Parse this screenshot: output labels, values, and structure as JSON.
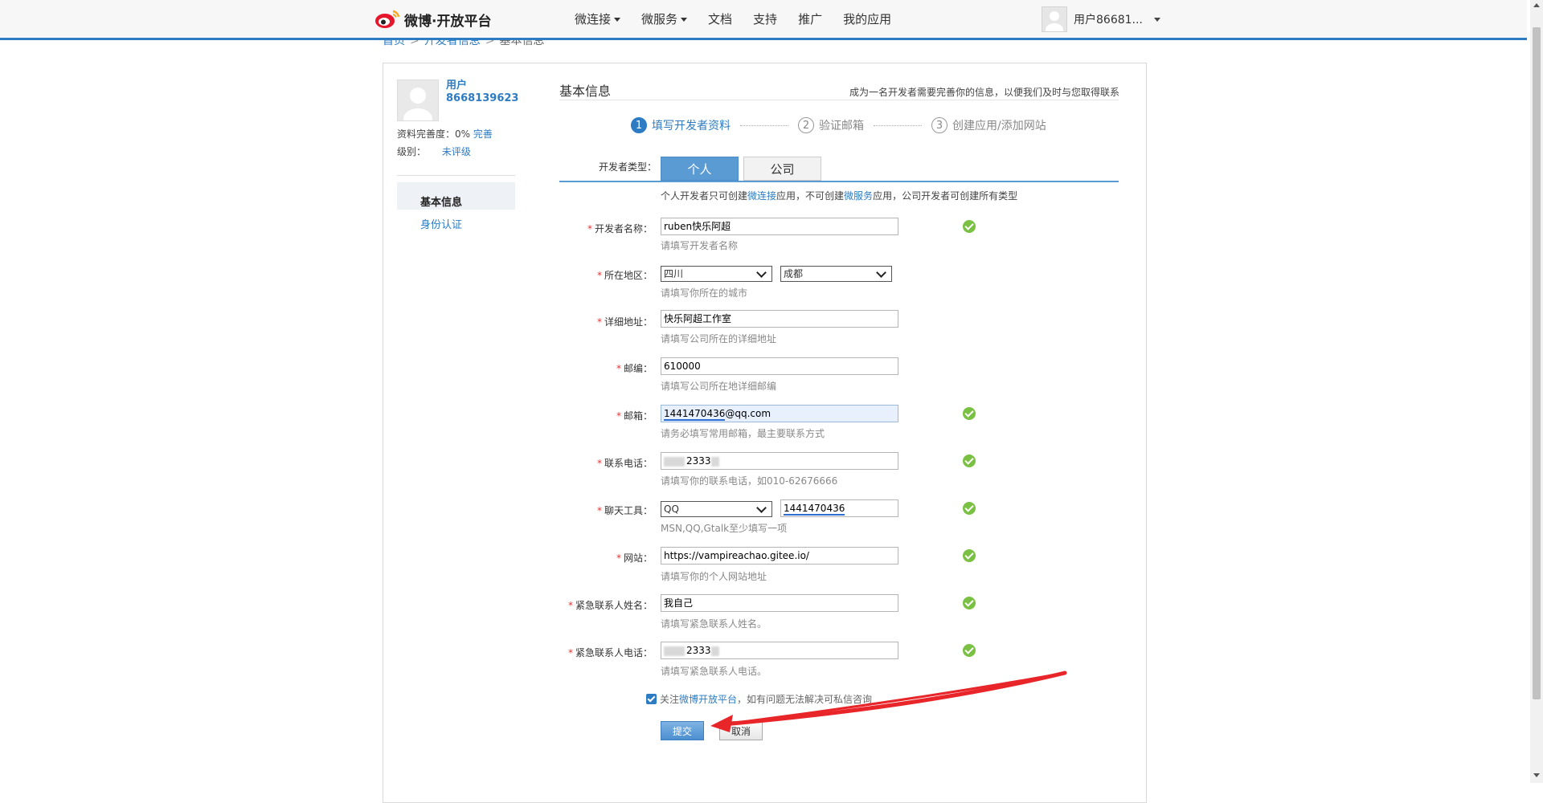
{
  "brand": {
    "logo_text": "微博·开放平台"
  },
  "nav": {
    "items": [
      {
        "label": "微连接",
        "dropdown": true
      },
      {
        "label": "微服务",
        "dropdown": true
      },
      {
        "label": "文档",
        "dropdown": false
      },
      {
        "label": "支持",
        "dropdown": false
      },
      {
        "label": "推广",
        "dropdown": false
      },
      {
        "label": "我的应用",
        "dropdown": false
      }
    ],
    "user_name": "用户86681..."
  },
  "breadcrumb": {
    "home": "首页",
    "dev_info": "开发者信息",
    "current": "基本信息",
    "sep": ">"
  },
  "sidebar": {
    "user_line1": "用户",
    "user_line2": "8668139623",
    "completion_label": "资料完善度：0%",
    "completion_link": "完善",
    "level_label": "级别：",
    "level_value": "未评级",
    "menu": [
      {
        "label": "基本信息",
        "active": true
      },
      {
        "label": "身份认证",
        "active": false
      }
    ]
  },
  "content": {
    "title": "基本信息",
    "tip": "成为一名开发者需要完善你的信息，以便我们及时与您取得联系",
    "steps": [
      {
        "num": "1",
        "label": "填写开发者资料",
        "active": true
      },
      {
        "num": "2",
        "label": "验证邮箱",
        "active": false
      },
      {
        "num": "3",
        "label": "创建应用/添加网站",
        "active": false
      }
    ],
    "devtype_label": "开发者类型：",
    "tabs": [
      {
        "label": "个人"
      },
      {
        "label": "公司"
      }
    ],
    "devtype_note": {
      "p1": "个人开发者只可创建",
      "l1": "微连接",
      "p2": "应用，不可创建",
      "l2": "微服务",
      "p3": "应用，公司开发者可创建所有类型"
    }
  },
  "form": {
    "name": {
      "label": "开发者名称：",
      "value": "ruben快乐阿超",
      "hint": "请填写开发者名称"
    },
    "region": {
      "label": "所在地区：",
      "province": "四川",
      "city": "成都",
      "hint": "请填写你所在的城市"
    },
    "address": {
      "label": "详细地址：",
      "value": "快乐阿超工作室",
      "hint": "请填写公司所在的详细地址"
    },
    "zipcode": {
      "label": "邮编：",
      "value": "610000",
      "hint": "请填写公司所在地详细邮编"
    },
    "email": {
      "label": "邮箱：",
      "value_a": "1441470436",
      "value_b": "@qq.com",
      "hint": "请务必填写常用邮箱，最主要联系方式"
    },
    "phone": {
      "label": "联系电话：",
      "value": "2333",
      "hint": "请填写你的联系电话，如010-62676666"
    },
    "chat": {
      "label": "聊天工具：",
      "tool": "QQ",
      "value": "1441470436",
      "hint": "MSN,QQ,Gtalk至少填写一项"
    },
    "website": {
      "label": "网站：",
      "value": "https://vampireachao.gitee.io/",
      "hint": "请填写你的个人网站地址"
    },
    "emergency_name": {
      "label": "紧急联系人姓名：",
      "value": "我自己",
      "hint": "请填写紧急联系人姓名。"
    },
    "emergency_phone": {
      "label": "紧急联系人电话：",
      "value": "2333",
      "hint": "请填写紧急联系人电话。"
    },
    "follow": {
      "p1": "关注",
      "link": "微博开放平台",
      "p2": "，如有问题无法解决可私信咨询"
    },
    "submit": "提交",
    "cancel": "取消"
  },
  "colors": {
    "accent": "#2d7cc3",
    "tab_active": "#5b9bd4",
    "valid": "#7ac143",
    "annotation": "#e8262a"
  }
}
